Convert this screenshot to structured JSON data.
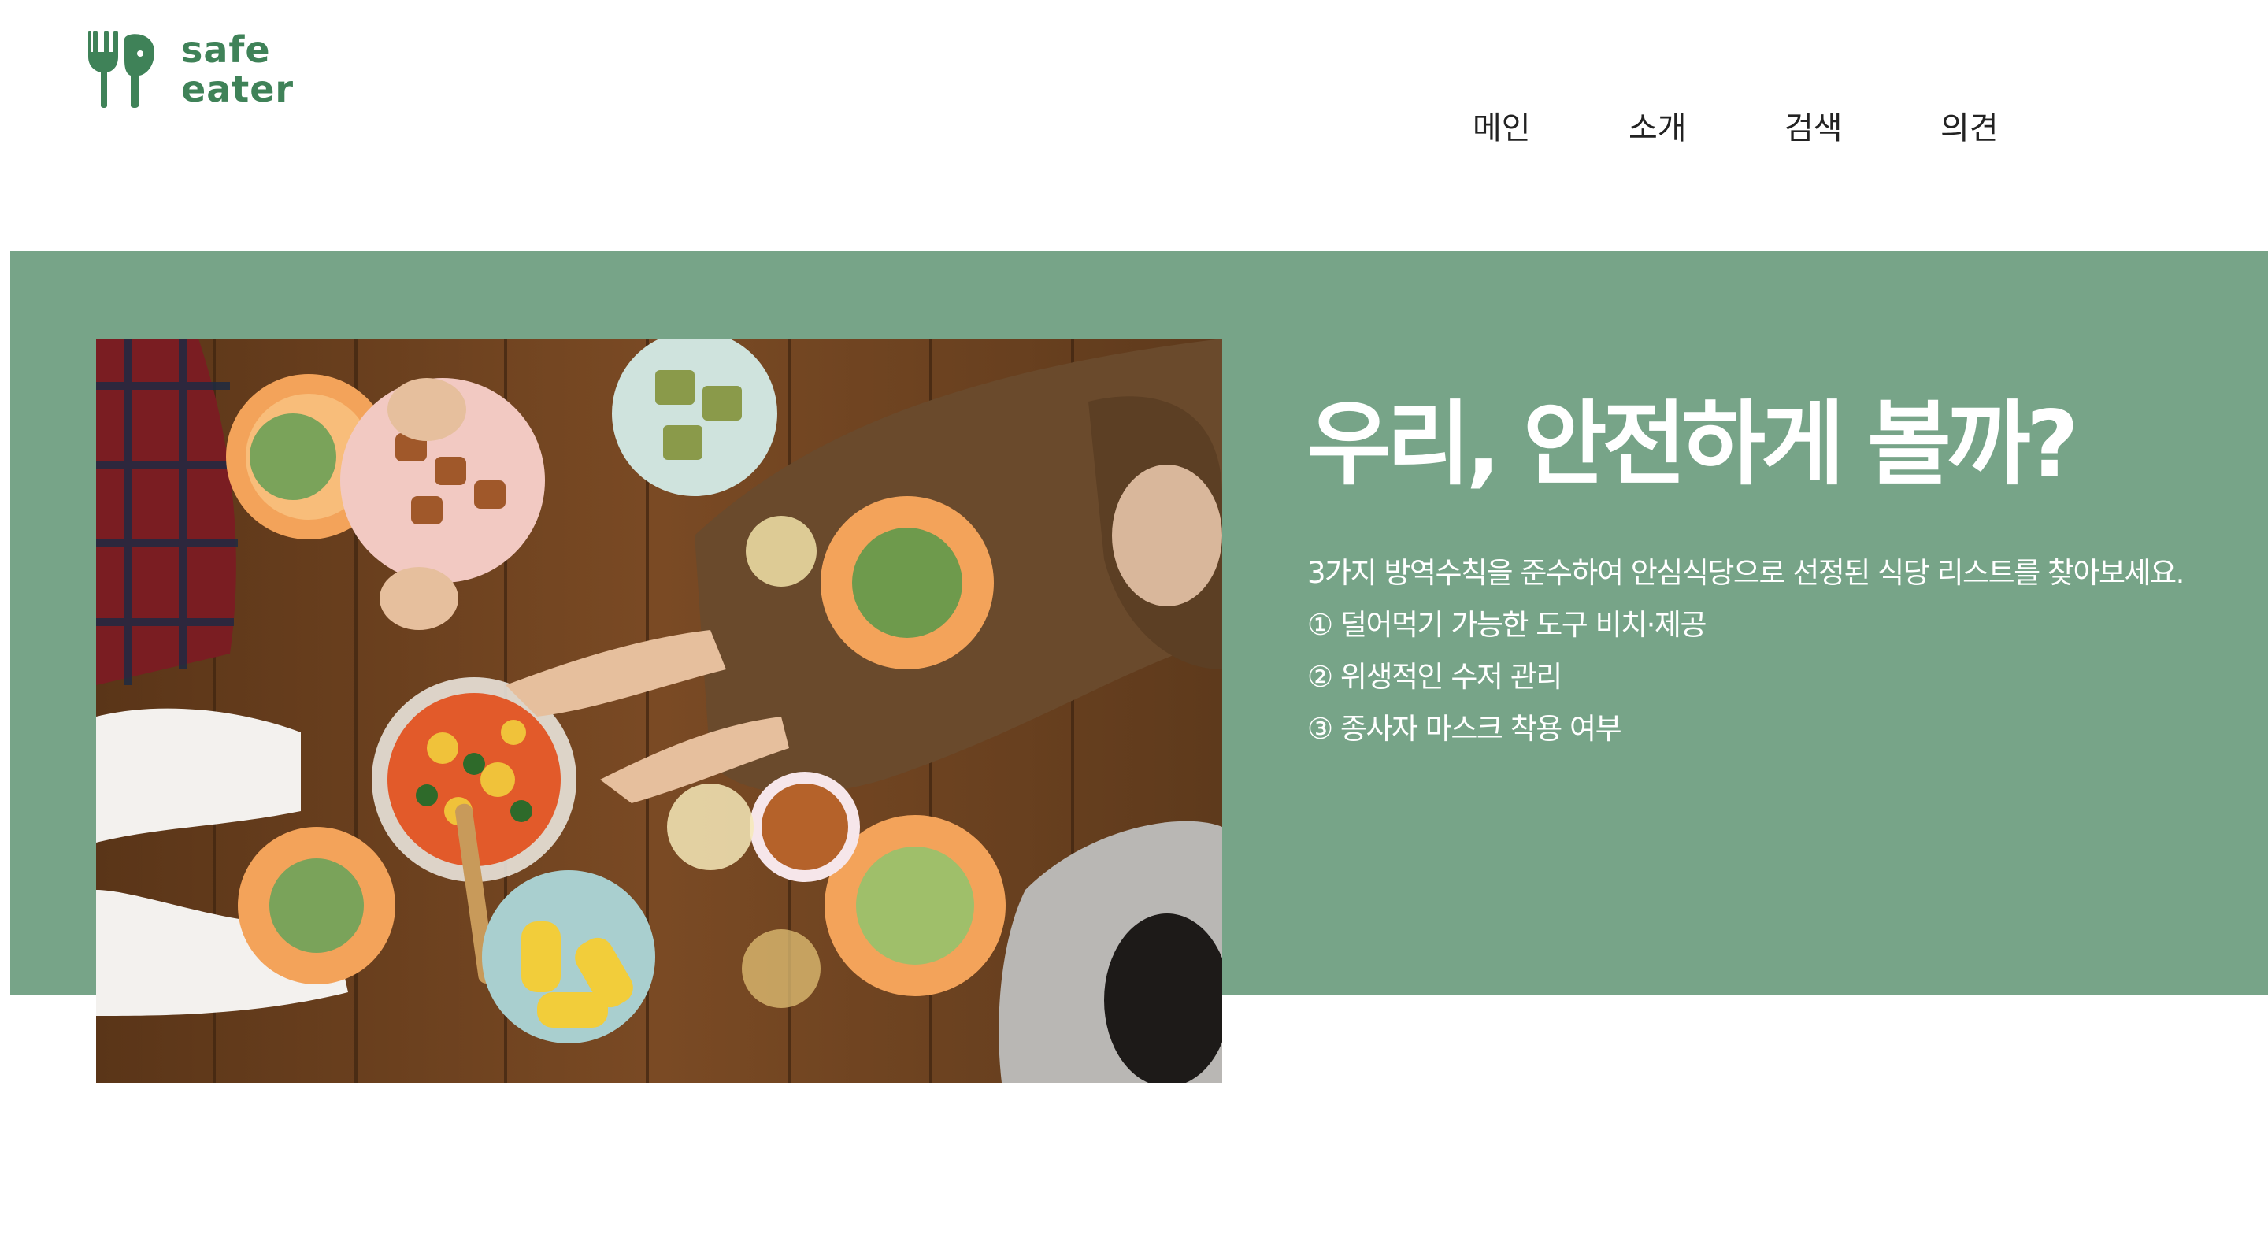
{
  "header": {
    "logo": {
      "line1": "safe",
      "line2": "eater",
      "icon": "spoon-fork-logo-icon"
    },
    "nav": [
      {
        "label": "메인"
      },
      {
        "label": "소개"
      },
      {
        "label": "검색"
      },
      {
        "label": "의견"
      }
    ]
  },
  "hero": {
    "title": "우리, 안전하게 볼까?",
    "lines": [
      "3가지 방역수칙을 준수하여 안심식당으로 선정된 식당 리스트를 찾아보세요.",
      "① 덜어먹기 가능한 도구 비치·제공",
      "② 위생적인 수저 관리",
      "③ 종사자 마스크 착용 여부"
    ],
    "image": "overhead photo of people sharing dishes on a wooden table"
  },
  "colors": {
    "brand": "#3f8258",
    "hero_background": "#77a488",
    "hero_text": "#ffffff",
    "nav_text": "#222222"
  }
}
